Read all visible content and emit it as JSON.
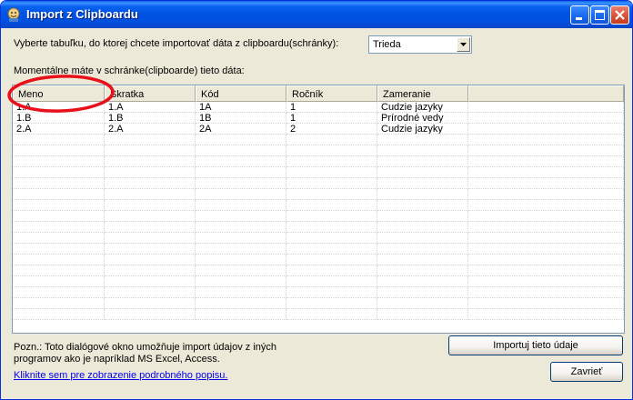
{
  "window": {
    "title": "Import z Clipboardu",
    "icon": "app-icon"
  },
  "labels": {
    "select_table": "Vyberte tabuľku, do ktorej chcete importovať dáta z clipboardu(schránky):",
    "clipboard_info": "Momentálne máte v schránke(clipboarde) tieto dáta:",
    "note_line1": "Pozn.: Toto dialógové okno umožňuje import údajov z iných",
    "note_line2": "programov ako je napríklad MS Excel, Access."
  },
  "combo": {
    "value": "Trieda"
  },
  "grid": {
    "columns": [
      "Meno",
      "Skratka",
      "Kód",
      "Ročník",
      "Zameranie",
      ""
    ],
    "rows": [
      [
        "1.A",
        "1.A",
        "1A",
        "1",
        "Cudzie jazyky",
        ""
      ],
      [
        "1.B",
        "1.B",
        "1B",
        "1",
        "Prírodné vedy",
        ""
      ],
      [
        "2.A",
        "2.A",
        "2A",
        "2",
        "Cudzie jazyky",
        ""
      ]
    ],
    "empty_rows": 17
  },
  "buttons": {
    "import": "Importuj tieto údaje",
    "close": "Zavrieť"
  },
  "link": {
    "text": "Kliknite sem pre zobrazenie podrobného popisu."
  },
  "colors": {
    "titlebar": "#0054e3",
    "annotation": "#e8101a",
    "link": "#0000ee"
  }
}
